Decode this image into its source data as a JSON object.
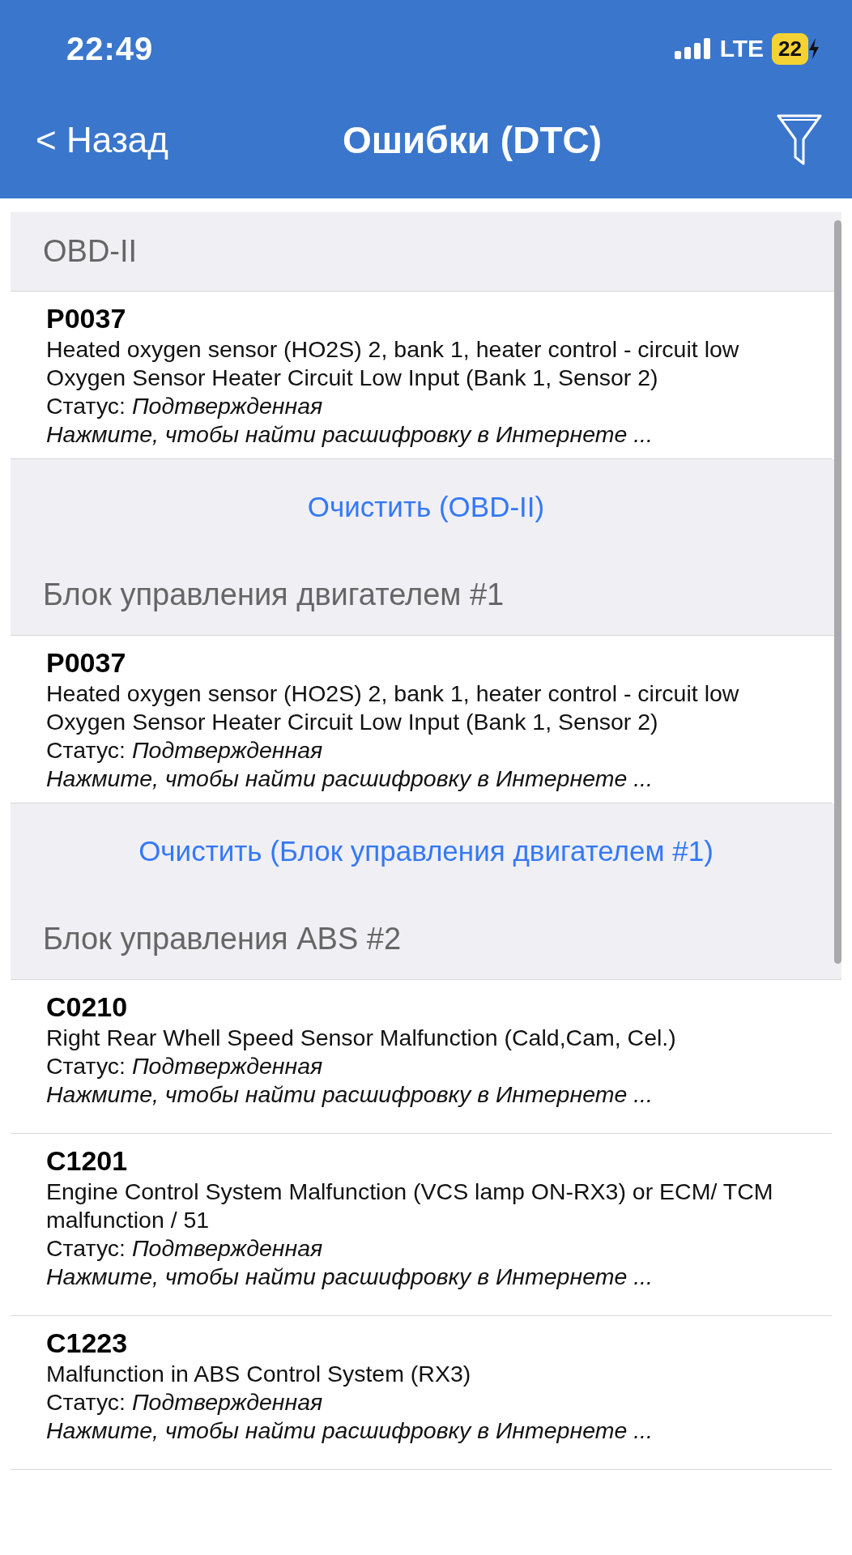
{
  "status_bar": {
    "time": "22:49",
    "network": "LTE",
    "battery": "22"
  },
  "nav": {
    "back": "< Назад",
    "title": "Ошибки (DTC)"
  },
  "sections": [
    {
      "title": "OBD-II",
      "errors": [
        {
          "code": "P0037",
          "description": [
            "Heated oxygen sensor (HO2S) 2, bank 1, heater control - circuit low",
            "Oxygen Sensor Heater Circuit Low Input (Bank 1, Sensor 2)"
          ],
          "status": "Статус: *Подтвержденная*",
          "hint": "Нажмите, чтобы найти расшифровку в Интернете ..."
        }
      ],
      "clear_button": "Очистить (OBD-II)"
    },
    {
      "title": "Блок управления двигателем #1",
      "errors": [
        {
          "code": "P0037",
          "description": [
            "Heated oxygen sensor (HO2S) 2, bank 1, heater control - circuit low",
            "Oxygen Sensor Heater Circuit Low Input (Bank 1, Sensor 2)"
          ],
          "status": "Статус: *Подтвержденная*",
          "hint": "Нажмите, чтобы найти расшифровку в Интернете ..."
        }
      ],
      "clear_button": "Очистить (Блок управления двигателем #1)"
    },
    {
      "title": "Блок управления ABS #2",
      "errors": [
        {
          "code": "C0210",
          "description": [
            "Right Rear Whell Speed Sensor Malfunction (Cald,Cam, Cel.)"
          ],
          "status": "Статус: *Подтвержденная*",
          "hint": "Нажмите, чтобы найти расшифровку в Интернете ..."
        },
        {
          "code": "C1201",
          "description": [
            "Engine Control System Malfunction (VCS lamp ON-RX3) or ECM/ TCM malfunction / 51"
          ],
          "status": "Статус: *Подтвержденная*",
          "hint": "Нажмите, чтобы найти расшифровку в Интернете ..."
        },
        {
          "code": "C1223",
          "description": [
            "Malfunction in ABS Control System (RX3)"
          ],
          "status": "Статус: *Подтвержденная*",
          "hint": "Нажмите, чтобы найти расшифровку в Интернете ..."
        }
      ]
    }
  ]
}
